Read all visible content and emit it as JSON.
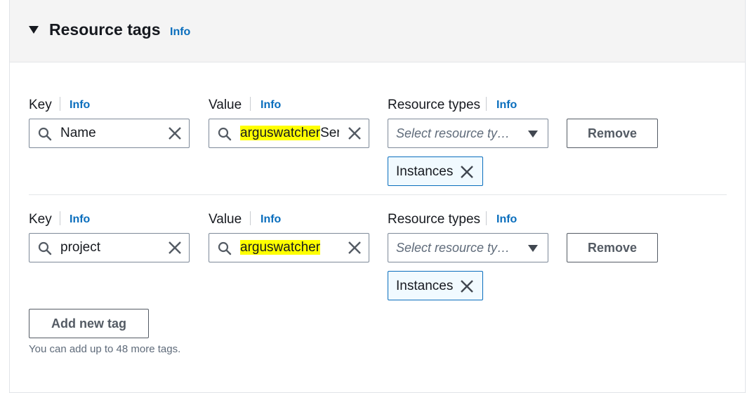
{
  "section": {
    "title": "Resource tags",
    "info_label": "Info"
  },
  "tags": [
    {
      "key_label": "Key",
      "key_info": "Info",
      "key_value": "Name",
      "value_label": "Value",
      "value_info": "Info",
      "value_highlight": "arguswatcher",
      "value_rest": "Ser",
      "types_label": "Resource types",
      "types_info": "Info",
      "types_placeholder": "Select resource ty…",
      "remove_label": "Remove",
      "token_label": "Instances"
    },
    {
      "key_label": "Key",
      "key_info": "Info",
      "key_value": "project",
      "value_label": "Value",
      "value_info": "Info",
      "value_highlight": "arguswatcher",
      "value_rest": "",
      "types_label": "Resource types",
      "types_info": "Info",
      "types_placeholder": "Select resource ty…",
      "remove_label": "Remove",
      "token_label": "Instances"
    }
  ],
  "add_button_label": "Add new tag",
  "hint_text": "You can add up to 48 more tags.",
  "colors": {
    "link": "#0a6ebd",
    "highlight": "#ffff00",
    "token_bg": "#f1faff",
    "header_bg": "#f4f4f4"
  },
  "icons": [
    "caret-down-icon",
    "search-icon",
    "close-icon",
    "dropdown-triangle-icon"
  ]
}
